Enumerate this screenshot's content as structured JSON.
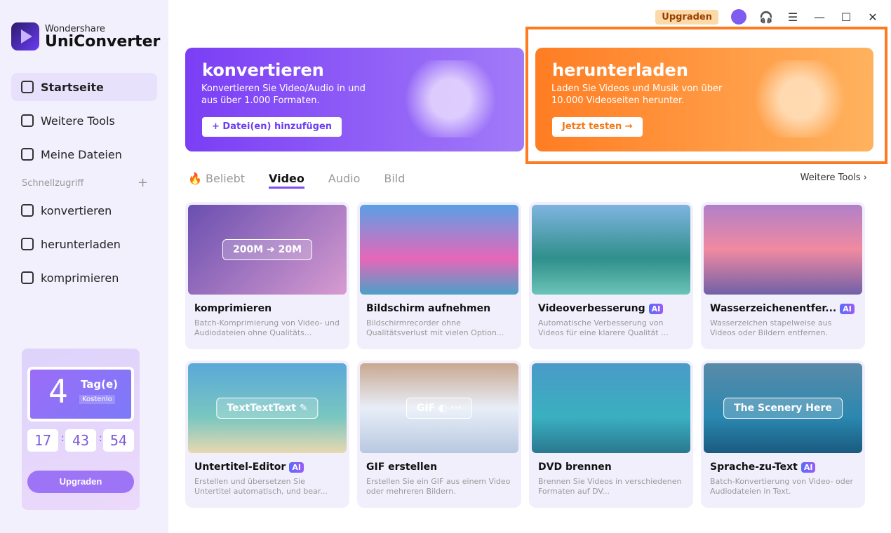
{
  "app": {
    "brand_top": "Wondershare",
    "brand_name": "UniConverter"
  },
  "sidebar": {
    "items": [
      {
        "label": "Startseite"
      },
      {
        "label": "Weitere Tools"
      },
      {
        "label": "Meine Dateien"
      }
    ],
    "quick_title": "Schnellzugriff",
    "quick_add": "+",
    "quick_items": [
      {
        "label": "konvertieren"
      },
      {
        "label": "herunterladen"
      },
      {
        "label": "komprimieren"
      }
    ],
    "promo": {
      "days": "4",
      "unit": "Tag(e)",
      "free": "Kostenlo",
      "hours": "17",
      "minutes": "43",
      "seconds": "54",
      "button": "Upgraden"
    }
  },
  "topbar": {
    "upgrade": "Upgraden"
  },
  "banners": [
    {
      "title": "konvertieren",
      "desc": "Konvertieren Sie Video/Audio in und aus über 1.000 Formaten.",
      "button": "+ Datei(en) hinzufügen"
    },
    {
      "title": "herunterladen",
      "desc": "Laden Sie Videos und Musik von über 10.000 Videoseiten herunter.",
      "button": "Jetzt testen →"
    }
  ],
  "tabs": [
    {
      "label": "🔥 Beliebt"
    },
    {
      "label": "Video"
    },
    {
      "label": "Audio"
    },
    {
      "label": "Bild"
    }
  ],
  "more_tools": "Weitere Tools ›",
  "cards": [
    {
      "title": "komprimieren",
      "ai": "",
      "desc": "Batch-Komprimierung von Video- und Audiodateien ohne Qualitäts...",
      "overlay": "200M ➜ 20M",
      "bg": "linear-gradient(135deg,#6a4fb0,#d79bd0)"
    },
    {
      "title": "Bildschirm aufnehmen",
      "ai": "",
      "desc": "Bildschirmrecorder ohne Qualitätsverlust mit vielen Option...",
      "overlay": "",
      "bg": "linear-gradient(180deg,#5aa0e6,#e667b8 60%,#4aa0c8)"
    },
    {
      "title": "Videoverbesserung",
      "ai": "AI",
      "desc": "Automatische Verbesserung von Videos für eine klarere Qualität ...",
      "overlay": "",
      "bg": "linear-gradient(180deg,#7fb4e0,#2f8f8a 60%,#6bc4b8)"
    },
    {
      "title": "Wasserzeichenentfer...",
      "ai": "AI",
      "desc": "Wasserzeichen stapelweise aus Videos oder Bildern entfernen.",
      "overlay": "",
      "bg": "linear-gradient(180deg,#b080c8,#f08aa0 50%,#7060a8)"
    },
    {
      "title": "Untertitel-Editor",
      "ai": "AI",
      "desc": "Erstellen und übersetzen Sie Untertitel automatisch, und bear...",
      "overlay": "TextTextText ✎",
      "bg": "linear-gradient(180deg,#5aa8d8,#79c7c0 60%,#e8d8b0)"
    },
    {
      "title": "GIF erstellen",
      "ai": "",
      "desc": "Erstellen Sie ein GIF aus einem Video oder mehreren Bildern.",
      "overlay": "GIF ◐ ···",
      "bg": "linear-gradient(180deg,#c8a890,#e8eef8 50%,#b8c8e0)"
    },
    {
      "title": "DVD brennen",
      "ai": "",
      "desc": "Brennen Sie Videos in verschiedenen Formaten auf DV...",
      "overlay": "",
      "bg": "linear-gradient(180deg,#4a9ac8,#3ab0c0 60%,#2a7890)"
    },
    {
      "title": "Sprache-zu-Text",
      "ai": "AI",
      "desc": "Batch-Konvertierung von Video- oder Audiodateien in Text.",
      "overlay": "The Scenery Here",
      "bg": "linear-gradient(180deg,#5a8aa8,#2a88b0 60%,#1a5a80)"
    }
  ]
}
